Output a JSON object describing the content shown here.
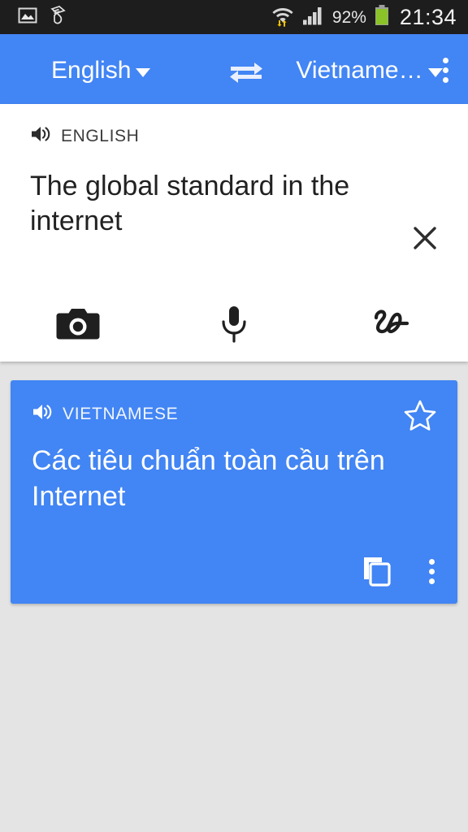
{
  "status_bar": {
    "left_icons": [
      "image-icon",
      "hand-cash-icon"
    ],
    "wifi_icon": "wifi-with-transfer-arrows-icon",
    "signal_icon": "cellular-signal-icon",
    "battery_percent": "92%",
    "battery_icon": "battery-icon",
    "clock": "21:34",
    "background": "#1D1D1D",
    "accent": "#4285F4"
  },
  "toolbar": {
    "source_language": "English",
    "target_language": "Vietname…",
    "swap_icon": "swap-horizontal-icon",
    "overflow_icon": "overflow-menu-icon",
    "background": "#4285F4"
  },
  "source_panel": {
    "speaker_icon": "speaker-icon",
    "language_label": "ENGLISH",
    "close_icon": "close-icon",
    "text": "The global standard in the internet",
    "input_methods": [
      {
        "name": "camera-input-button",
        "icon": "camera-icon"
      },
      {
        "name": "voice-input-button",
        "icon": "microphone-icon"
      },
      {
        "name": "handwriting-input-button",
        "icon": "handwriting-icon"
      }
    ]
  },
  "translation_card": {
    "speaker_icon": "speaker-icon",
    "language_label": "VIETNAMESE",
    "star_icon": "star-outline-icon",
    "text": "Các tiêu chuẩn toàn cầu trên Internet",
    "copy_icon": "copy-icon",
    "overflow_icon": "overflow-menu-icon",
    "background": "#4285F4"
  },
  "page": {
    "background": "#E4E4E4"
  }
}
